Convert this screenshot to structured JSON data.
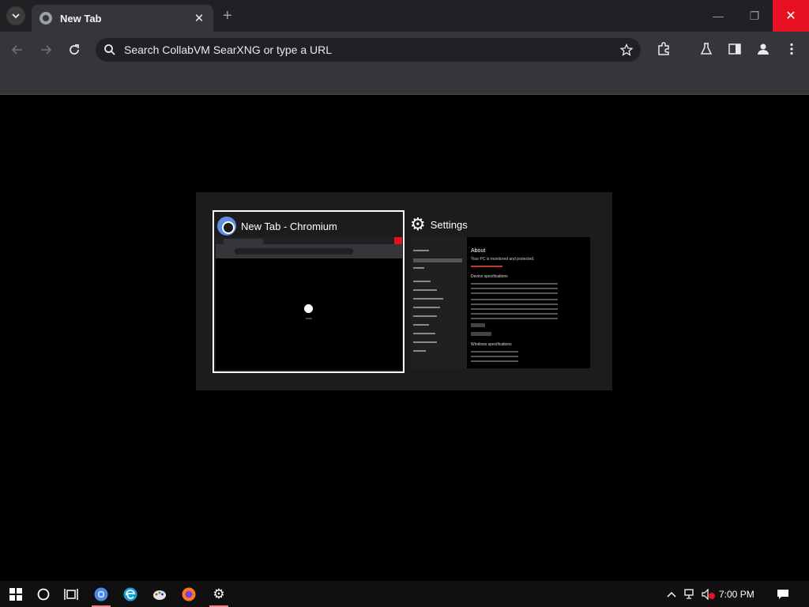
{
  "browser": {
    "tab_title": "New Tab",
    "tab_close": "✕",
    "new_tab": "+",
    "omnibox_placeholder": "Search CollabVM SearXNG or type a URL",
    "min_glyph": "—",
    "max_glyph": "❐",
    "close_glyph": "✕",
    "icons": [
      "tab-search-icon",
      "back-icon",
      "forward-icon",
      "reload-icon",
      "search-icon",
      "star-icon",
      "extensions-icon",
      "labs-icon",
      "side-panel-icon",
      "profile-icon",
      "menu-icon"
    ]
  },
  "switcher": {
    "windows": [
      {
        "label": "New Tab - Chromium",
        "icon": "chromium-icon",
        "selected": true
      },
      {
        "label": "Settings",
        "icon": "gear-icon",
        "selected": false
      }
    ],
    "settings_thumb": {
      "title": "About",
      "subtitle": "Your PC is monitored and protected.",
      "section_device": "Device specifications",
      "section_windows": "Windows specifications"
    }
  },
  "taskbar": {
    "clock": "7:00 PM",
    "apps": [
      "start-icon",
      "cortana-icon",
      "task-view-icon",
      "chromium-taskbar-icon",
      "edge-icon",
      "paint-icon",
      "firefox-icon",
      "settings-taskbar-icon"
    ]
  },
  "colors": {
    "close_red": "#e81123",
    "titlebar": "#202124",
    "toolbar": "#35363a",
    "taskbar": "#101010"
  }
}
